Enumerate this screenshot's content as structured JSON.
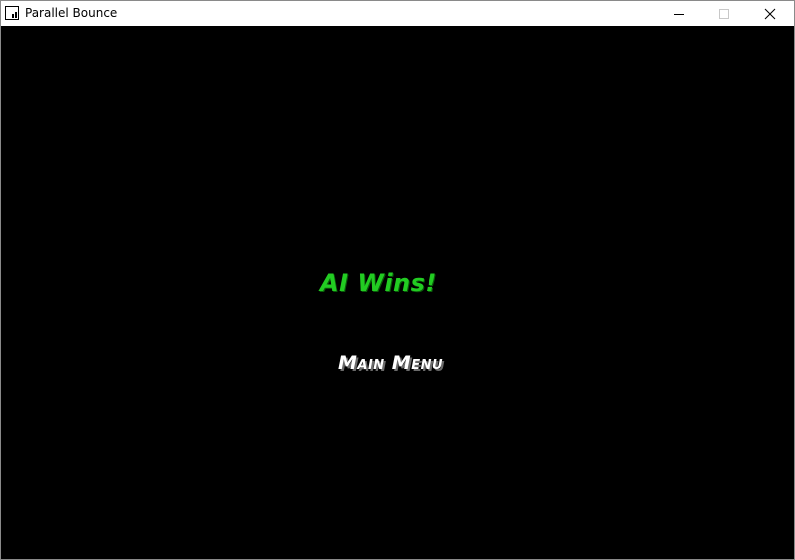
{
  "window": {
    "title": "Parallel Bounce",
    "icon": "app-window-icon",
    "controls": {
      "minimize_icon": "minimize-icon",
      "maximize_icon": "maximize-icon",
      "close_icon": "close-icon"
    }
  },
  "game": {
    "result_text": "AI Wins!",
    "result_color": "#22cc22",
    "menu_button_label": "Main Menu",
    "menu_button_color": "#ffffff",
    "background_color": "#000000"
  }
}
